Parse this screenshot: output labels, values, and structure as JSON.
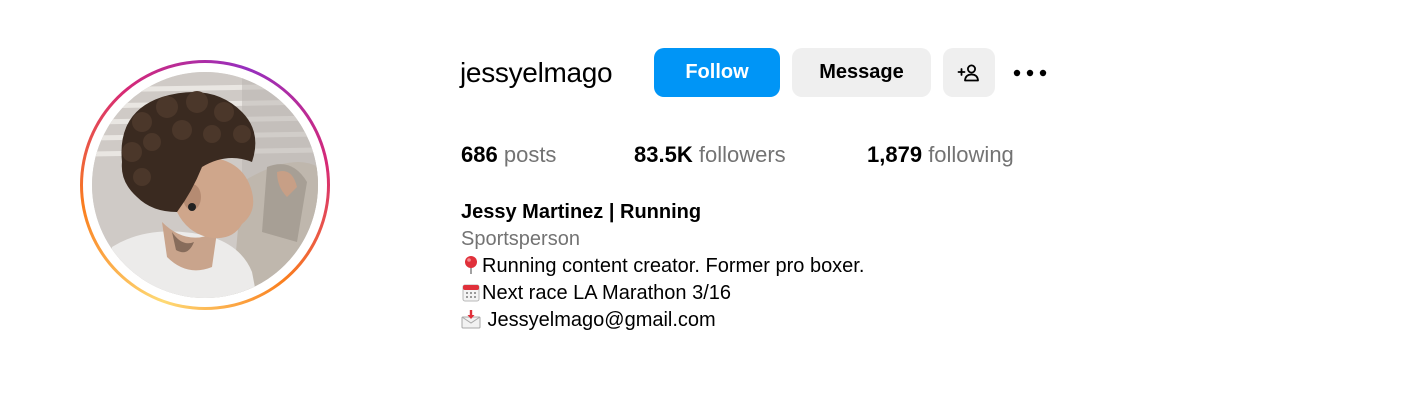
{
  "profile": {
    "username": "jessyelmago",
    "avatar_icon": "profile-photo",
    "story_ring_colors": [
      "#feda75",
      "#fa7e1e",
      "#d62976",
      "#962fbf"
    ]
  },
  "actions": {
    "follow_label": "Follow",
    "message_label": "Message",
    "suggest_icon": "add-person-icon",
    "more_icon": "more-options-icon",
    "follow_color": "#0095f6"
  },
  "stats": {
    "posts": {
      "value": "686",
      "label": "posts"
    },
    "followers": {
      "value": "83.5K",
      "label": "followers"
    },
    "following": {
      "value": "1,879",
      "label": "following"
    }
  },
  "bio": {
    "full_name": "Jessy Martinez | Running",
    "category": "Sportsperson",
    "lines": [
      {
        "icon": "round-pushpin-icon",
        "text": "Running content creator. Former pro boxer."
      },
      {
        "icon": "calendar-icon",
        "text": "Next race LA Marathon 3/16"
      },
      {
        "icon": "envelope-arrow-icon",
        "text": " Jessyelmago@gmail.com"
      }
    ]
  }
}
